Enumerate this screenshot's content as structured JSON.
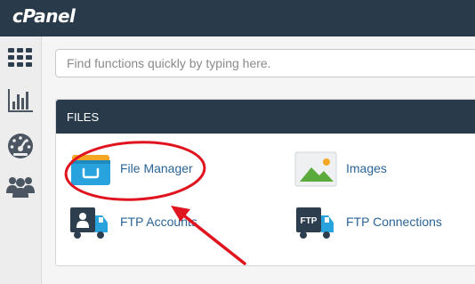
{
  "brand": {
    "logo_text": "cPanel"
  },
  "sidebar": {
    "items": [
      {
        "name": "home-grid-icon",
        "icon": "grid"
      },
      {
        "name": "statistics-icon",
        "icon": "bar-chart"
      },
      {
        "name": "dashboard-icon",
        "icon": "speedometer"
      },
      {
        "name": "users-icon",
        "icon": "people"
      }
    ]
  },
  "search": {
    "placeholder": "Find functions quickly by typing here.",
    "value": ""
  },
  "files_section": {
    "title": "FILES",
    "items": [
      {
        "label": "File Manager",
        "icon": "file-manager-icon"
      },
      {
        "label": "Images",
        "icon": "images-icon"
      },
      {
        "label": "FTP Accounts",
        "icon": "ftp-accounts-icon"
      },
      {
        "label": "FTP Connections",
        "icon": "ftp-connections-icon"
      }
    ]
  },
  "annotation": {
    "highlight": "File Manager",
    "color": "#e0141e"
  },
  "colors": {
    "topbar": "#293a4a",
    "link": "#2a6496",
    "folder_blue": "#29a3dd",
    "folder_orange": "#f5a623"
  }
}
